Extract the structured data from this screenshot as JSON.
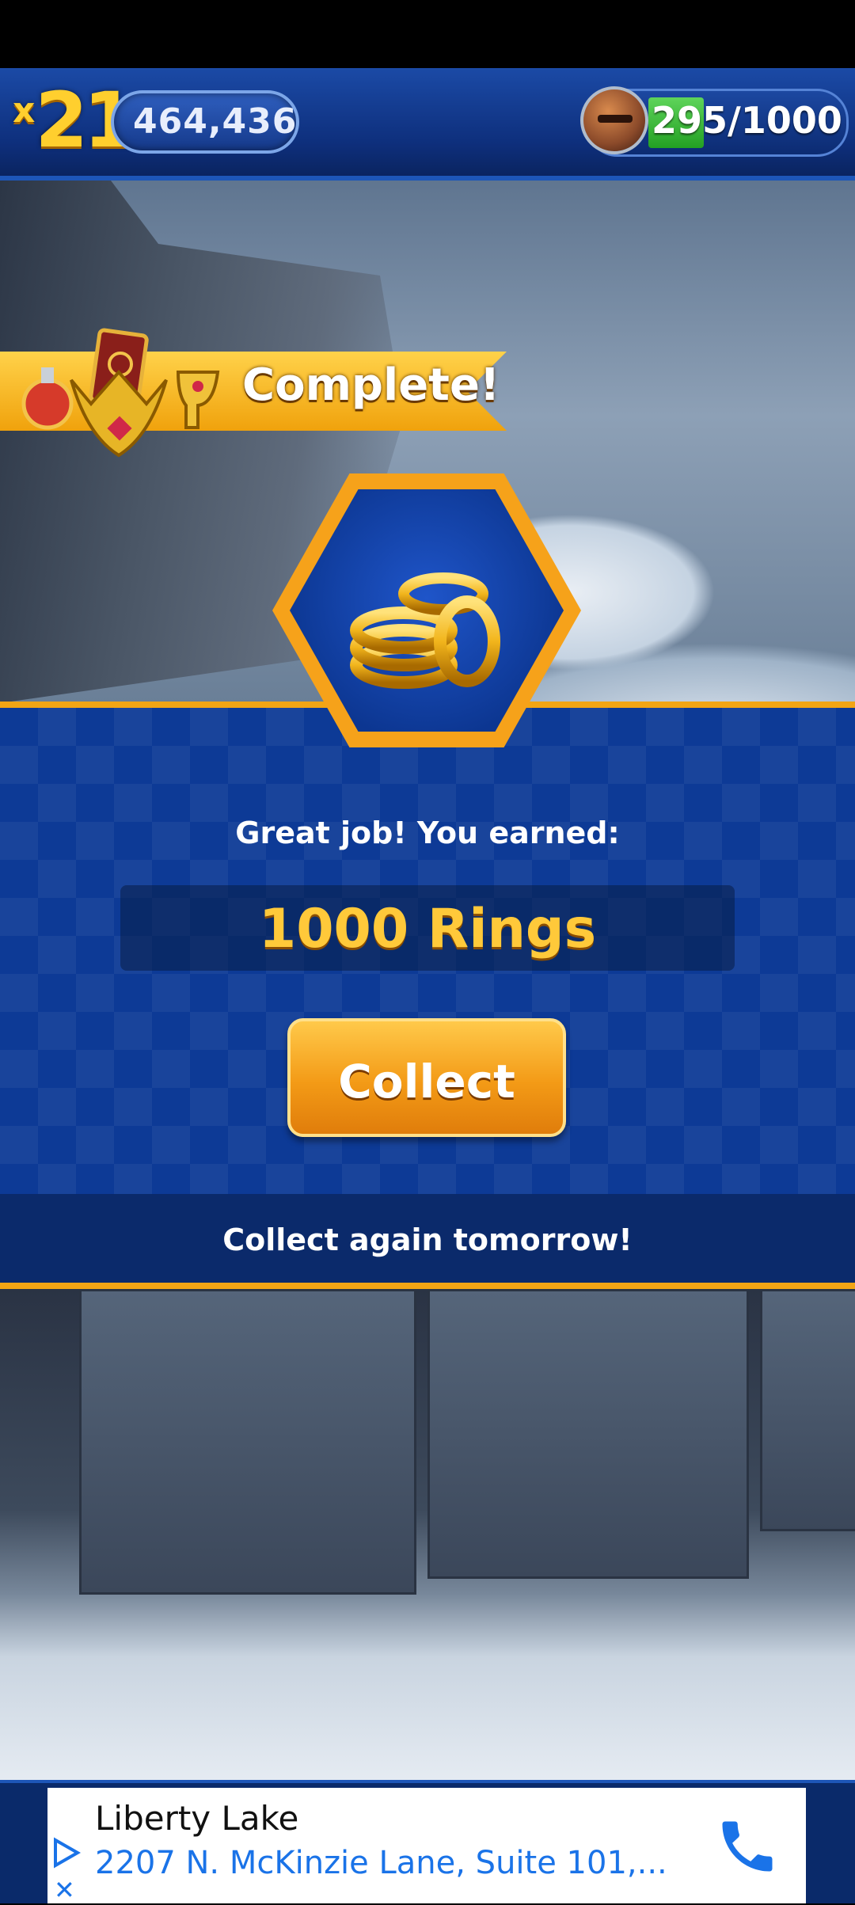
{
  "hud": {
    "multiplier_prefix": "x",
    "multiplier_value": "21",
    "score": "464,436",
    "energy_text": "295/1000",
    "energy_fraction": 0.295
  },
  "banner": {
    "complete_label": "Complete!"
  },
  "reward": {
    "heading": "Great job! You earned:",
    "amount": "1000 Rings",
    "collect_label": "Collect"
  },
  "footer": {
    "message": "Collect again tomorrow!"
  },
  "ad": {
    "title": "Liberty Lake",
    "address": "2207 N. McKinzie Lane, Suite 101,...",
    "accent_color": "#1a73e8"
  },
  "icons": [
    "knight-avatar-icon",
    "trophy-cluster-icon",
    "gold-rings-icon",
    "ad-play-icon",
    "close-icon",
    "phone-icon"
  ]
}
